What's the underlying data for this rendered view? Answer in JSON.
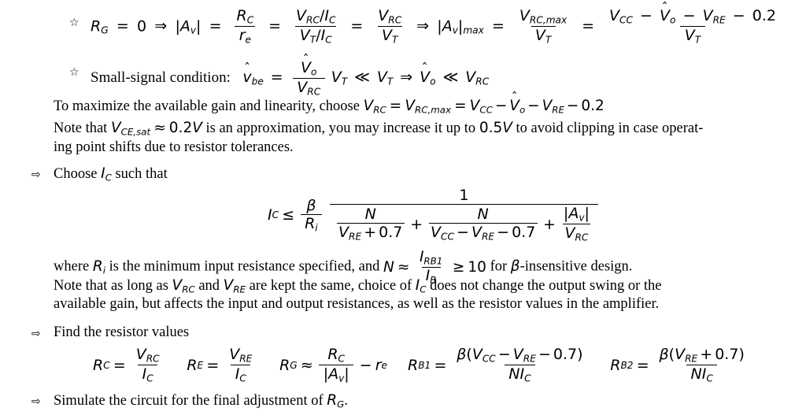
{
  "document": {
    "type": "lecture-notes-page",
    "topic": "BJT common-emitter amplifier design procedure",
    "background_color": "#ffffff",
    "text_color": "#000000"
  },
  "bullets": {
    "star_glyph": "☆",
    "arrow_glyph": "⇨"
  },
  "line1": {
    "bullet": "☆",
    "lhs_R": "R",
    "lhs_R_sub": "G",
    "eq1": "=",
    "zero": "0",
    "implies1": "⇒",
    "abs_open": "|",
    "A": "A",
    "A_sub": "v",
    "abs_close": "|",
    "eq2": "=",
    "f1_num_R": "R",
    "f1_num_sub": "C",
    "f1_den_r": "r",
    "f1_den_sub": "e",
    "eq3": "=",
    "f2_num": "V",
    "f2_num_sub": "RC",
    "f2_num_slash": "/",
    "f2_num_I": "I",
    "f2_num_I_sub": "C",
    "f2_den": "V",
    "f2_den_sub": "T",
    "f2_den_slash": "/",
    "f2_den_I": "I",
    "f2_den_I_sub": "C",
    "eq4": "=",
    "f3_num": "V",
    "f3_num_sub": "RC",
    "f3_den": "V",
    "f3_den_sub": "T",
    "implies2": "⇒",
    "max_label": "max",
    "eq5": "=",
    "f4_num": "V",
    "f4_num_sub": "RC,max",
    "f4_den": "V",
    "f4_den_sub": "T",
    "eq6": "=",
    "f5_num_VCC": "V",
    "f5_num_VCC_sub": "CC",
    "minus1": "−",
    "f5_num_Vo": "V",
    "f5_num_Vo_sub": "o",
    "hat": "ˆ",
    "minus2": "−",
    "f5_num_VRE": "V",
    "f5_num_VRE_sub": "RE",
    "minus3": "−",
    "f5_num_const": "0.2",
    "f5_den": "V",
    "f5_den_sub": "T"
  },
  "line2": {
    "bullet": "☆",
    "text": "Small-signal condition:",
    "v": "v",
    "v_sub": "be",
    "eq": "=",
    "num_V": "V",
    "num_V_sub": "o",
    "den_V": "V",
    "den_V_sub": "RC",
    "VT1": "V",
    "VT1_sub": "T",
    "ll1": "≪",
    "VT2": "V",
    "VT2_sub": "T",
    "implies": "⇒",
    "Vo": "V",
    "Vo_sub": "o",
    "ll2": "≪",
    "VRC": "V",
    "VRC_sub": "RC"
  },
  "para1": {
    "text_before": "To maximize the available gain and linearity, choose ",
    "VRC": "V",
    "VRC_sub": "RC",
    "eq1": "=",
    "VRCmax": "V",
    "VRCmax_sub": "RC,max",
    "eq2": "=",
    "VCC": "V",
    "VCC_sub": "CC",
    "minus1": "−",
    "Vo": "V",
    "Vo_sub": "o",
    "minus2": "−",
    "VRE": "V",
    "VRE_sub": "RE",
    "minus3": "−",
    "const": "0.2"
  },
  "para2": {
    "l1_a": "Note that ",
    "VCE": "V",
    "VCE_sub": "CE,sat",
    "approx": "≈",
    "val1": "0.2",
    "unit1": "V",
    "l1_b": " is an approximation, you may increase it up to ",
    "val2": "0.5",
    "unit2": "V",
    "l1_c": " to avoid clipping in case operat-",
    "l2": "ing point shifts due to resistor tolerances."
  },
  "bullet1": {
    "bullet": "⇨",
    "text_a": "Choose ",
    "I": "I",
    "I_sub": "C",
    "text_b": " such that"
  },
  "eq_ic": {
    "I": "I",
    "I_sub": "C",
    "leq": "≤",
    "beta": "β",
    "R": "R",
    "R_sub": "i",
    "big_num": "1",
    "t1_num": "N",
    "t1_den_V": "V",
    "t1_den_sub": "RE",
    "t1_den_op": "+",
    "t1_den_c": "0.7",
    "plus1": "+",
    "t2_num": "N",
    "t2_den_VCC": "V",
    "t2_den_VCC_sub": "CC",
    "t2_den_op1": "−",
    "t2_den_VRE": "V",
    "t2_den_VRE_sub": "RE",
    "t2_den_op2": "−",
    "t2_den_c": "0.7",
    "plus2": "+",
    "t3_num_abs_open": "|",
    "t3_num_A": "A",
    "t3_num_A_sub": "v",
    "t3_num_abs_close": "|",
    "t3_den": "V",
    "t3_den_sub": "RC"
  },
  "para3": {
    "a": "where ",
    "R": "R",
    "R_sub": "i",
    "b": " is the minimum input resistance specified, and ",
    "N": "N",
    "approx": "≈",
    "num_I": "I",
    "num_I_sub": "RB1",
    "den_I": "I",
    "den_I_sub": "B",
    "geq": "≥",
    "ten": "10",
    "c": " for ",
    "beta": "β",
    "d": "-insensitive design."
  },
  "para4": {
    "l1_a": "Note that as long as ",
    "VRC": "V",
    "VRC_sub": "RC",
    "l1_b": " and ",
    "VRE": "V",
    "VRE_sub": "RE",
    "l1_c": " are kept the same, choice of ",
    "IC": "I",
    "IC_sub": "C",
    "l1_d": " does not change the output swing or the",
    "l2": "available gain, but affects the input and output resistances, as well as the resistor values in the amplifier."
  },
  "bullet2": {
    "bullet": "⇨",
    "text": "Find the resistor values"
  },
  "eq_resistors": {
    "rc": {
      "R": "R",
      "R_sub": "C",
      "eq": "=",
      "num": "V",
      "num_sub": "RC",
      "den": "I",
      "den_sub": "C"
    },
    "re": {
      "R": "R",
      "R_sub": "E",
      "eq": "=",
      "num": "V",
      "num_sub": "RE",
      "den": "I",
      "den_sub": "C"
    },
    "rg": {
      "R": "R",
      "R_sub": "G",
      "approx": "≈",
      "num": "R",
      "num_sub": "C",
      "den_abs_open": "|",
      "den_A": "A",
      "den_A_sub": "v",
      "den_abs_close": "|",
      "minus": "−",
      "re": "r",
      "re_sub": "e"
    },
    "rb1": {
      "R": "R",
      "R_sub": "B1",
      "eq": "=",
      "beta": "β",
      "paren_open": "(",
      "VCC": "V",
      "VCC_sub": "CC",
      "op1": "−",
      "VRE": "V",
      "VRE_sub": "RE",
      "op2": "−",
      "c": "0.7",
      "paren_close": ")",
      "den_N": "N",
      "den_I": "I",
      "den_I_sub": "C"
    },
    "rb2": {
      "R": "R",
      "R_sub": "B2",
      "eq": "=",
      "beta": "β",
      "paren_open": "(",
      "VRE": "V",
      "VRE_sub": "RE",
      "op1": "+",
      "c": "0.7",
      "paren_close": ")",
      "den_N": "N",
      "den_I": "I",
      "den_I_sub": "C"
    }
  },
  "bullet3": {
    "bullet": "⇨",
    "text_a": "Simulate the circuit for the final adjustment of ",
    "R": "R",
    "R_sub": "G",
    "text_b": "."
  }
}
